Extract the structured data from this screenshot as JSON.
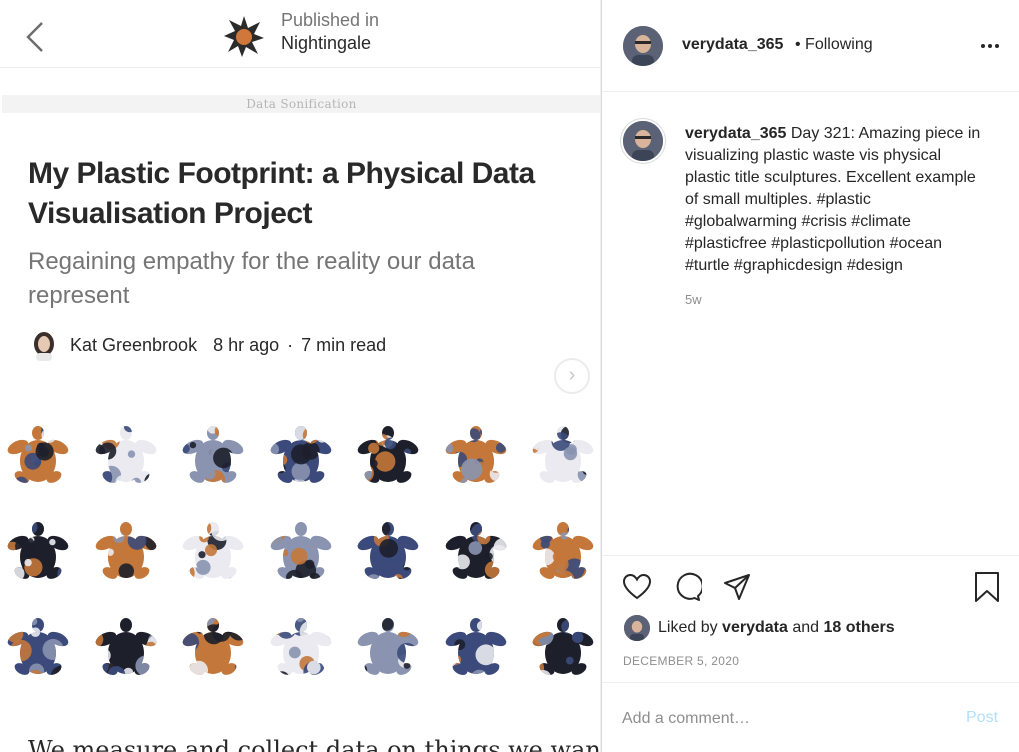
{
  "article": {
    "publisher_prefix": "Published in",
    "publisher_name": "Nightingale",
    "tag": "Data Sonification",
    "title": "My Plastic Footprint: a Physical Data Visualisation Project",
    "subtitle": "Regaining empathy for the reality our data represent",
    "author": "Kat Greenbrook",
    "time_ago": "8 hr ago",
    "separator": "·",
    "read_time": "7 min read",
    "next_glyph": "›",
    "body_start": "We measure and collect data on things we want",
    "turtle_rows": 3,
    "turtle_cols": 7,
    "turtle_colors": [
      "#c4773a",
      "#3b4a7a",
      "#eaeaf0",
      "#1d1f2b",
      "#8a94b0"
    ]
  },
  "post": {
    "username": "verydata_365",
    "follow_status": "• Following",
    "more_icon": "more-horizontal-icon",
    "caption_user": "verydata_365",
    "caption_text": "Day 321: Amazing piece in visualizing plastic waste vis physical plastic title sculptures. Excellent example of small multiples. #plastic #globalwarming #crisis #climate #plasticfree #plasticpollution #ocean #turtle #graphicdesign #design",
    "time": "5w",
    "liked_prefix": "Liked by",
    "liked_user": "verydata",
    "liked_and": "and",
    "liked_others": "18 others",
    "date": "DECEMBER 5, 2020",
    "comment_placeholder": "Add a comment…",
    "post_label": "Post"
  },
  "icons": [
    "back-chevron-icon",
    "nightingale-logo-icon",
    "heart-icon",
    "comment-icon",
    "share-icon",
    "bookmark-icon"
  ],
  "colors": {
    "text": "#262626",
    "muted": "#8e8e8e",
    "post_disabled": "#b2dffc",
    "turtle_orange": "#c4773a",
    "turtle_navy": "#3b4a7a"
  }
}
